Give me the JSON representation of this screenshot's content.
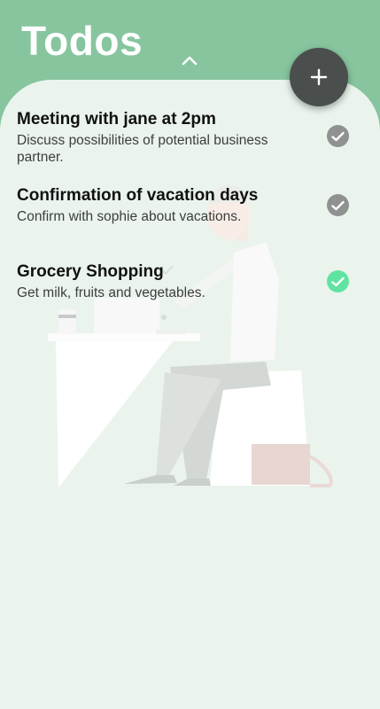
{
  "app": {
    "title": "Todos"
  },
  "colors": {
    "header_bg": "#87c59e",
    "sheet_bg": "#eaf4ed",
    "fab_bg": "#4a4e4c",
    "check_pending": "#8f9290",
    "check_done": "#5fe3a1"
  },
  "header": {
    "collapse_icon": "chevron-up-icon",
    "add_icon": "plus-icon"
  },
  "todos": [
    {
      "title": "Meeting with jane at 2pm",
      "description": "Discuss possibilities of potential business partner.",
      "completed": false
    },
    {
      "title": "Confirmation of vacation days",
      "description": "Confirm with sophie about vacations.",
      "completed": false
    },
    {
      "title": "Grocery Shopping",
      "description": "Get milk, fruits and vegetables.",
      "completed": true
    }
  ]
}
